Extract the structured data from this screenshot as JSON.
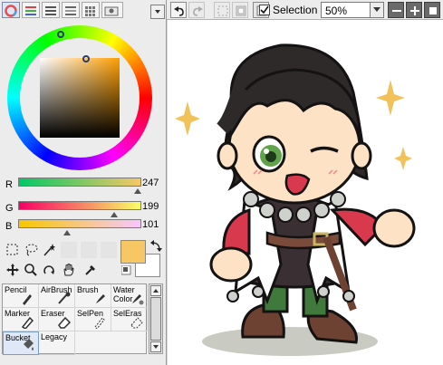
{
  "color_panel": {
    "modes": [
      "color-wheel-mode",
      "rgb-slider-mode",
      "hsv-slider-mode",
      "swatches-mode",
      "palette-mode",
      "user-mode"
    ],
    "rgb": {
      "r_label": "R",
      "r_value": "247",
      "g_label": "G",
      "g_value": "199",
      "b_label": "B",
      "b_value": "101"
    },
    "current_color": "#f7c765",
    "sub_color": "#ffffff",
    "hue_color": "#ff9f00",
    "slider_levels": {
      "r": 0.969,
      "g": 0.78,
      "b": 0.396
    }
  },
  "tools": [
    {
      "label": "Pencil",
      "icon": "pencil-icon"
    },
    {
      "label": "AirBrush",
      "icon": "airbrush-icon"
    },
    {
      "label": "Brush",
      "icon": "brush-icon"
    },
    {
      "label": "Water\nColor",
      "icon": "watercolor-icon"
    },
    {
      "label": "Marker",
      "icon": "marker-icon"
    },
    {
      "label": "Eraser",
      "icon": "eraser-icon"
    },
    {
      "label": "SelPen",
      "icon": "selpen-icon"
    },
    {
      "label": "SelEras",
      "icon": "seleras-icon"
    },
    {
      "label": "Bucket",
      "icon": "bucket-icon",
      "selected": true
    },
    {
      "label": "Legacy",
      "icon": ""
    }
  ],
  "toolbar": {
    "selection_label": "Selection",
    "selection_checked": true,
    "zoom_value": "50%"
  },
  "canvas": {
    "artwork": "chibi character illustration"
  }
}
